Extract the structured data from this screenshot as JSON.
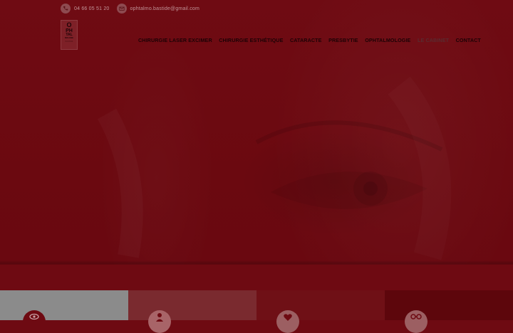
{
  "topbar": {
    "phone": "04 66 05 51 20",
    "email": "ophtalmo.bastide@gmail.com",
    "phone_icon": "phone-icon",
    "email_icon": "mail-icon"
  },
  "logo": {
    "line1": "O",
    "line2": "PH",
    "line3": "TAL",
    "line4": "MOLOGIE",
    "line5": "BASTIDE"
  },
  "nav": {
    "items": [
      {
        "label": "Chirurgie Laser Excimer"
      },
      {
        "label": "Chirurgie Esthétique"
      },
      {
        "label": "Cataracte"
      },
      {
        "label": "Presbytie"
      },
      {
        "label": "Ophtalmologie"
      },
      {
        "label": "Le Cabinet"
      },
      {
        "label": "Contact"
      }
    ]
  },
  "tiles": [
    {
      "icon": "eye-icon",
      "color": "#8b8b8b"
    },
    {
      "icon": "user-icon",
      "color": "#7a2a2f"
    },
    {
      "icon": "heart-icon",
      "color": "#6f1016"
    },
    {
      "icon": "glasses-icon",
      "color": "#5d060c"
    }
  ],
  "colors": {
    "background": "#6e0a12",
    "nav_text": "#1c0205",
    "topbar_text": "#c29599"
  }
}
